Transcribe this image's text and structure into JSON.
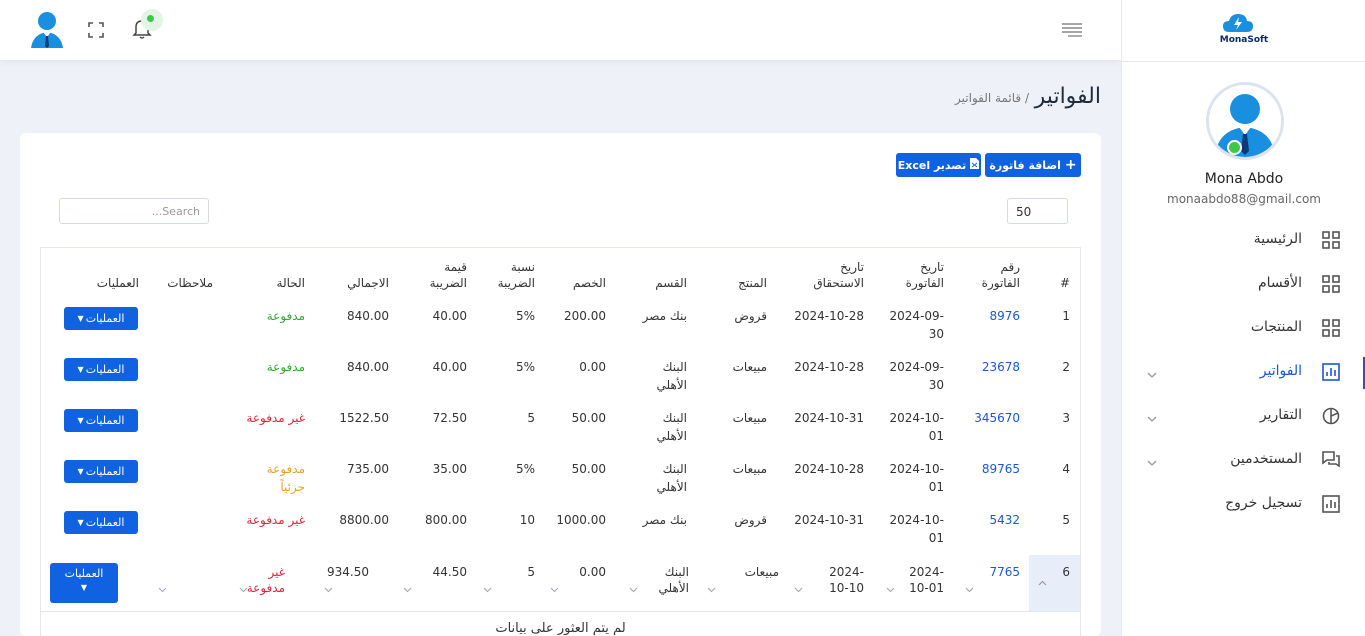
{
  "brand": {
    "name": "MonaSoft"
  },
  "user": {
    "name": "Mona Abdo",
    "email": "monaabdo88@gmail.com"
  },
  "nav": [
    {
      "label": "الرئيسية",
      "icon": "grid-icon",
      "has_children": false,
      "active": false
    },
    {
      "label": "الأقسام",
      "icon": "grid-icon",
      "has_children": false,
      "active": false
    },
    {
      "label": "المنتجات",
      "icon": "grid-icon",
      "has_children": false,
      "active": false
    },
    {
      "label": "الفواتير",
      "icon": "bar-chart-icon",
      "has_children": true,
      "active": true
    },
    {
      "label": "التقارير",
      "icon": "pie-chart-icon",
      "has_children": true,
      "active": false
    },
    {
      "label": "المستخدمين",
      "icon": "chat-icon",
      "has_children": true,
      "active": false
    },
    {
      "label": "تسجيل خروج",
      "icon": "bar-chart-icon",
      "has_children": false,
      "active": false
    }
  ],
  "page": {
    "title": "الفواتير",
    "breadcrumb": "/ قائمة الفواتير"
  },
  "toolbar": {
    "add_label": "اضافة فاتورة",
    "export_label": "تصدير Excel"
  },
  "search": {
    "placeholder": "Search..."
  },
  "page_size": "50",
  "table": {
    "headers": {
      "index": "#",
      "invoice_number": "رقم الفاتورة",
      "invoice_date": "تاريخ الفاتورة",
      "due_date": "تاريخ الاستحقاق",
      "product": "المنتج",
      "section": "القسم",
      "discount": "الخصم",
      "tax_rate": "نسبة الضريبة",
      "tax_value": "قيمة الضريبة",
      "total": "الاجمالي",
      "status": "الحالة",
      "notes": "ملاحظات",
      "actions": "العمليات"
    },
    "rows": [
      {
        "index": "1",
        "invoice_number": "8976",
        "invoice_date_1": "2024-09-",
        "invoice_date_2": "30",
        "due_date": "2024-10-28",
        "product": "قروض",
        "section_1": "بنك مصر",
        "section_2": "",
        "discount": "200.00",
        "tax_rate": "5%",
        "tax_value": "40.00",
        "total": "840.00",
        "status_1": "مدفوعة",
        "status_2": "",
        "status_type": "paid",
        "actions": "العمليات"
      },
      {
        "index": "2",
        "invoice_number": "23678",
        "invoice_date_1": "2024-09-",
        "invoice_date_2": "30",
        "due_date": "2024-10-28",
        "product": "مبيعات",
        "section_1": "البنك",
        "section_2": "الأهلي",
        "discount": "0.00",
        "tax_rate": "5%",
        "tax_value": "40.00",
        "total": "840.00",
        "status_1": "مدفوعة",
        "status_2": "",
        "status_type": "paid",
        "actions": "العمليات"
      },
      {
        "index": "3",
        "invoice_number": "345670",
        "invoice_date_1": "2024-10-",
        "invoice_date_2": "01",
        "due_date": "2024-10-31",
        "product": "مبيعات",
        "section_1": "البنك",
        "section_2": "الأهلي",
        "discount": "50.00",
        "tax_rate": "5",
        "tax_value": "72.50",
        "total": "1522.50",
        "status_1": "غير مدفوعة",
        "status_2": "",
        "status_type": "unpaid",
        "actions": "العمليات"
      },
      {
        "index": "4",
        "invoice_number": "89765",
        "invoice_date_1": "2024-10-",
        "invoice_date_2": "01",
        "due_date": "2024-10-28",
        "product": "مبيعات",
        "section_1": "البنك",
        "section_2": "الأهلي",
        "discount": "50.00",
        "tax_rate": "5%",
        "tax_value": "35.00",
        "total": "735.00",
        "status_1": "مدفوعة",
        "status_2": "جزئياً",
        "status_type": "partial",
        "actions": "العمليات"
      },
      {
        "index": "5",
        "invoice_number": "5432",
        "invoice_date_1": "2024-10-",
        "invoice_date_2": "01",
        "due_date": "2024-10-31",
        "product": "قروض",
        "section_1": "بنك مصر",
        "section_2": "",
        "discount": "1000.00",
        "tax_rate": "10",
        "tax_value": "800.00",
        "total": "8800.00",
        "status_1": "غير مدفوعة",
        "status_2": "",
        "status_type": "unpaid",
        "actions": "العمليات"
      }
    ],
    "expanded_row": {
      "index": "6",
      "invoice_number": "7765",
      "invoice_date_1": "2024-",
      "invoice_date_2": "10-01",
      "due_date_1": "2024-",
      "due_date_2": "10-10",
      "product": "مبيعات",
      "section_1": "البنك",
      "section_2": "الأهلي",
      "discount": "0.00",
      "tax_rate": "5",
      "tax_value": "44.50",
      "total": "934.50",
      "status_1": "غير",
      "status_2": "مدفوعة",
      "actions": "العمليات"
    },
    "empty_message": "لم يتم العثور على بيانات"
  },
  "colors": {
    "primary": "#1062e0",
    "paid": "#38a23b",
    "unpaid": "#e0263d",
    "partial": "#e6a02a"
  }
}
